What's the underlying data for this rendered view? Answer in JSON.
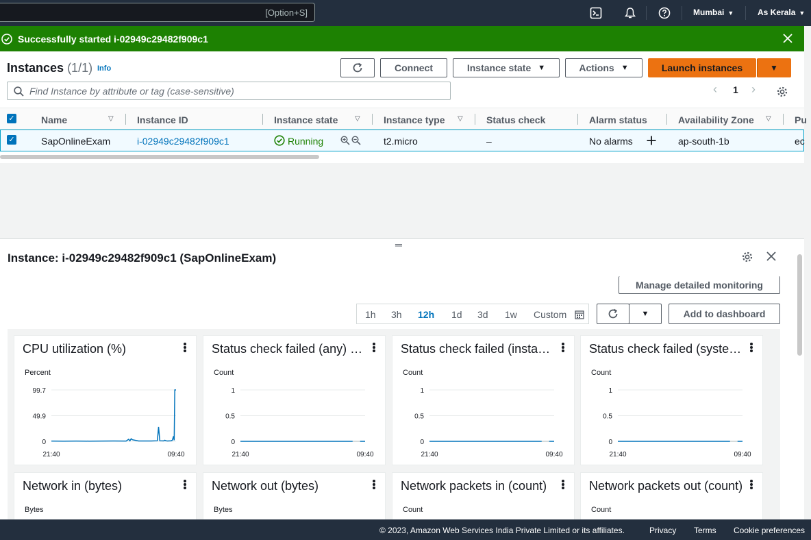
{
  "topnav": {
    "search_hint": "[Option+S]",
    "icons": [
      "cloudshell-icon",
      "bell-icon",
      "help-icon"
    ],
    "region": "Mumbai",
    "account": "As Kerala"
  },
  "flash": {
    "message": "Successfully started i-02949c29482f909c1",
    "color": "#1d8102"
  },
  "instances": {
    "title": "Instances",
    "count": "(1/1)",
    "info": "Info",
    "buttons": {
      "connect": "Connect",
      "instance_state": "Instance state",
      "actions": "Actions",
      "launch": "Launch instances"
    },
    "filter_placeholder": "Find Instance by attribute or tag (case-sensitive)",
    "page": "1",
    "columns": [
      "Name",
      "Instance ID",
      "Instance state",
      "Instance type",
      "Status check",
      "Alarm status",
      "Availability Zone",
      "Pu"
    ],
    "rows": [
      {
        "name": "SapOnlineExam",
        "instance_id": "i-02949c29482f909c1",
        "state": "Running",
        "type": "t2.micro",
        "status_check": "–",
        "alarm": "No alarms",
        "az": "ap-south-1b",
        "public": "ec"
      }
    ]
  },
  "details": {
    "title": "Instance: i-02949c29482f909c1 (SapOnlineExam)",
    "manage_monitoring": "Manage detailed monitoring",
    "ranges": [
      "1h",
      "3h",
      "12h",
      "1d",
      "3d",
      "1w",
      "Custom"
    ],
    "selected_range": "12h",
    "add_dashboard": "Add to dashboard"
  },
  "chart_data": [
    {
      "type": "line",
      "title": "CPU utilization (%)",
      "ylabel": "Percent",
      "yticks": [
        "99.7",
        "49.9",
        "0"
      ],
      "ylim": [
        0,
        99.7
      ],
      "xticks": [
        "21:40",
        "09:40"
      ],
      "x": [
        0,
        0.1,
        0.2,
        0.3,
        0.4,
        0.5,
        0.6,
        0.62,
        0.63,
        0.64,
        0.65,
        0.7,
        0.8,
        0.85,
        0.86,
        0.87,
        0.9,
        0.91,
        0.92,
        0.93,
        0.96,
        0.97,
        0.98,
        0.985,
        0.99,
        1.0
      ],
      "values": [
        0.5,
        0.4,
        0.5,
        0.4,
        0.5,
        0.6,
        0.5,
        4,
        1,
        5,
        3,
        0.6,
        0.7,
        1,
        28,
        1,
        0.8,
        2,
        1,
        0.7,
        1,
        2,
        10,
        2,
        99.7,
        99.7
      ],
      "color": "#0073bb"
    },
    {
      "type": "line",
      "title": "Status check failed (any) (count)",
      "ylabel": "Count",
      "yticks": [
        "1",
        "0.5",
        "0"
      ],
      "ylim": [
        0,
        1
      ],
      "xticks": [
        "21:40",
        "09:40"
      ],
      "x": [
        0,
        0.9
      ],
      "values": [
        0,
        0
      ],
      "color": "#0073bb"
    },
    {
      "type": "line",
      "title": "Status check failed (instance) (count)",
      "ylabel": "Count",
      "yticks": [
        "1",
        "0.5",
        "0"
      ],
      "ylim": [
        0,
        1
      ],
      "xticks": [
        "21:40",
        "09:40"
      ],
      "x": [
        0,
        0.9
      ],
      "values": [
        0,
        0
      ],
      "color": "#0073bb"
    },
    {
      "type": "line",
      "title": "Status check failed (system) (count)",
      "ylabel": "Count",
      "yticks": [
        "1",
        "0.5",
        "0"
      ],
      "ylim": [
        0,
        1
      ],
      "xticks": [
        "21:40",
        "09:40"
      ],
      "x": [
        0,
        0.9
      ],
      "values": [
        0,
        0
      ],
      "color": "#0073bb"
    },
    {
      "type": "line",
      "title": "Network in (bytes)",
      "ylabel": "Bytes"
    },
    {
      "type": "line",
      "title": "Network out (bytes)",
      "ylabel": "Bytes"
    },
    {
      "type": "line",
      "title": "Network packets in (count)",
      "ylabel": "Count"
    },
    {
      "type": "line",
      "title": "Network packets out (count)",
      "ylabel": "Count"
    }
  ],
  "footer": {
    "copyright": "© 2023, Amazon Web Services India Private Limited or its affiliates.",
    "privacy": "Privacy",
    "terms": "Terms",
    "cookies": "Cookie preferences"
  }
}
